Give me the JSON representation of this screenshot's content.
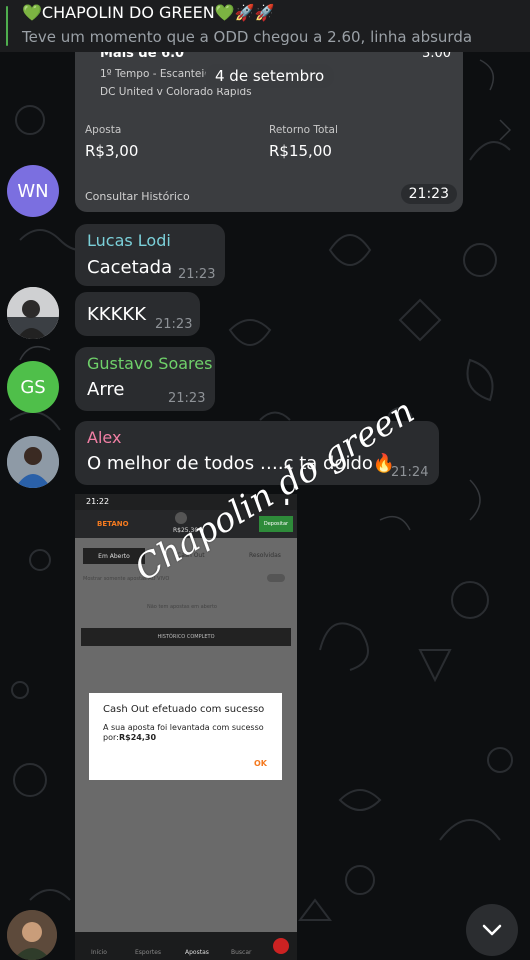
{
  "pinned": {
    "title": "💚CHAPOLIN DO GREEN💚🚀🚀",
    "text": "Teve um momento que a ODD chegou a 2.60, linha absurda"
  },
  "date_pill": "4 de setembro",
  "bet_card": {
    "header_left": "Mais de 6.0",
    "header_right": "3.00",
    "line1": "1º Tempo - Escanteios",
    "line2": "DC United v Colorado Rapids",
    "stake_label": "Aposta",
    "stake_value": "R$3,00",
    "return_label": "Retorno Total",
    "return_value": "R$15,00",
    "history": "Consultar Histórico",
    "time": "21:23"
  },
  "avatars": {
    "wn": "WN",
    "gs": "GS"
  },
  "messages": [
    {
      "sender": "Lucas Lodi",
      "text": "Cacetada",
      "time": "21:23"
    },
    {
      "sender": "",
      "text": "KKKKK",
      "time": "21:23"
    },
    {
      "sender": "Gustavo Soares",
      "text": "Arre",
      "time": "21:23"
    },
    {
      "sender": "Alex",
      "text": "O melhor de todos ….c ta doido🔥",
      "time": "21:24"
    }
  ],
  "colors": {
    "lucas": "#7bd0d9",
    "gustavo": "#6fd16a",
    "alex": "#f07fa4",
    "wn_avatar": "#7b6fe0",
    "gs_avatar": "#4fbf4a"
  },
  "screenshot": {
    "status_time": "21:22",
    "brand": "BETANO",
    "balance": "R$25,30",
    "deposit": "Depositar",
    "tab_open": "Em Aberto",
    "tab_cashout": "Cash Out",
    "tab_settled": "Resolvidas",
    "toggle_text": "Mostrar somente apostas AO VIVO",
    "empty_text": "Não tem apostas em aberto",
    "history_btn": "HISTÓRICO COMPLETO",
    "dialog_title": "Cash Out efetuado com sucesso",
    "dialog_body": "A sua aposta foi levantada com sucesso por:",
    "dialog_amount": "R$24,30",
    "dialog_ok": "OK",
    "nav_home": "Início",
    "nav_sports": "Esportes",
    "nav_bets": "Apostas",
    "nav_search": "Buscar"
  },
  "watermark": "Chapolin do green",
  "icons": {
    "scroll_down": "chevron-down-icon"
  }
}
